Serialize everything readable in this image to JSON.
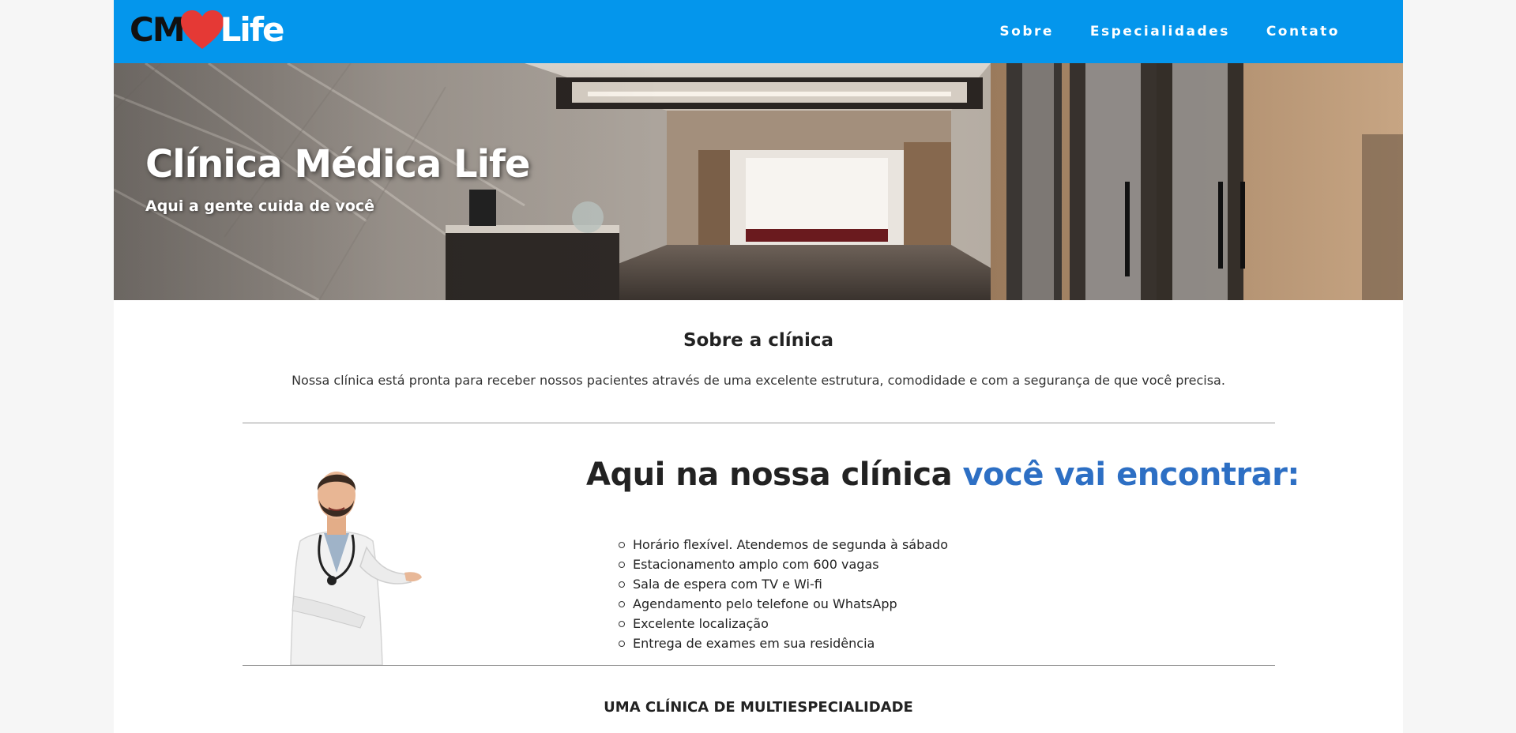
{
  "header": {
    "logo": {
      "part1": "CM",
      "part2": "Life",
      "heart_icon": "heart-icon",
      "heart_color": "#e53935"
    },
    "nav": [
      {
        "label": "Sobre"
      },
      {
        "label": "Especialidades"
      },
      {
        "label": "Contato"
      }
    ],
    "background_color": "#0496ec"
  },
  "hero": {
    "title": "Clínica Médica Life",
    "subtitle": "Aqui a gente cuida de você",
    "image": "clinic-interior-photo"
  },
  "about": {
    "title": "Sobre a clínica",
    "text": "Nossa clínica está pronta para receber nossos pacientes através de uma excelente estrutura, comodidade e com a segurança de que você precisa."
  },
  "features": {
    "image": "doctor-photo",
    "title_part1": "Aqui na nossa clínica ",
    "title_part2": "você vai encontrar:",
    "accent_color": "#2d6fc4",
    "items": [
      "Horário flexível. Atendemos de segunda à sábado",
      "Estacionamento amplo com 600 vagas",
      "Sala de espera com TV e Wi-fi",
      "Agendamento pelo telefone ou WhatsApp",
      "Excelente localização",
      "Entrega de exames em sua residência"
    ]
  },
  "multi": {
    "title": "UMA CLÍNICA DE MULTIESPECIALIDADE"
  }
}
